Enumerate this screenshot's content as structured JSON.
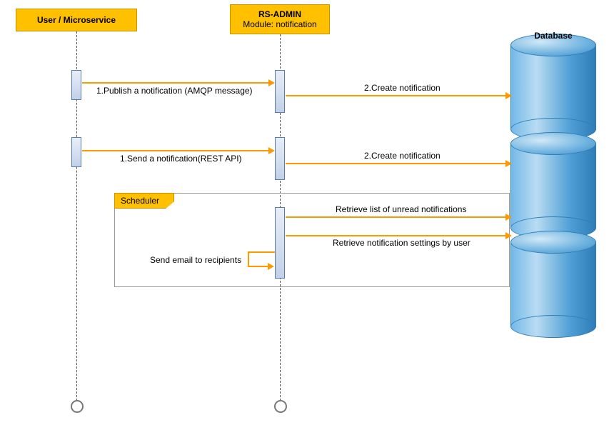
{
  "participants": {
    "user": {
      "title": "User / Microservice"
    },
    "rsadmin": {
      "title": "RS-ADMIN",
      "subtitle": "Module: notification"
    },
    "database": {
      "title": "Database"
    }
  },
  "frame": {
    "label": "Scheduler"
  },
  "messages": {
    "m1": "1.Publish a notification (AMQP message)",
    "m2a": "2.Create notification",
    "m3": "1.Send a notification(REST API)",
    "m2b": "2.Create notification",
    "m4": "Retrieve list of unread notifications",
    "m5": "Retrieve notification settings by user",
    "m6": "Send email to recipients"
  }
}
